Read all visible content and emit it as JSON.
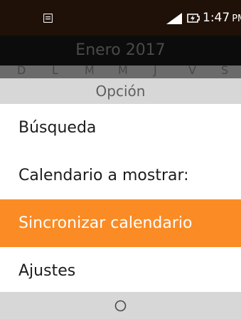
{
  "status_bar": {
    "time": "1:47",
    "ampm": "PM",
    "icons": [
      "sim-card-icon",
      "signal-icon",
      "battery-charging-icon"
    ]
  },
  "calendar": {
    "month_title": "Enero 2017",
    "weekdays": [
      "D",
      "L",
      "M",
      "M",
      "J",
      "V",
      "S"
    ]
  },
  "options_menu": {
    "title": "Opción",
    "items": [
      {
        "label": "Búsqueda"
      },
      {
        "label": "Calendario a mostrar:"
      },
      {
        "label": "Sincronizar calendario"
      },
      {
        "label": "Ajustes"
      }
    ],
    "selected_index": 2,
    "accent_color": "#fb8b24"
  },
  "softkeys": {
    "center": "circle-select-icon"
  }
}
